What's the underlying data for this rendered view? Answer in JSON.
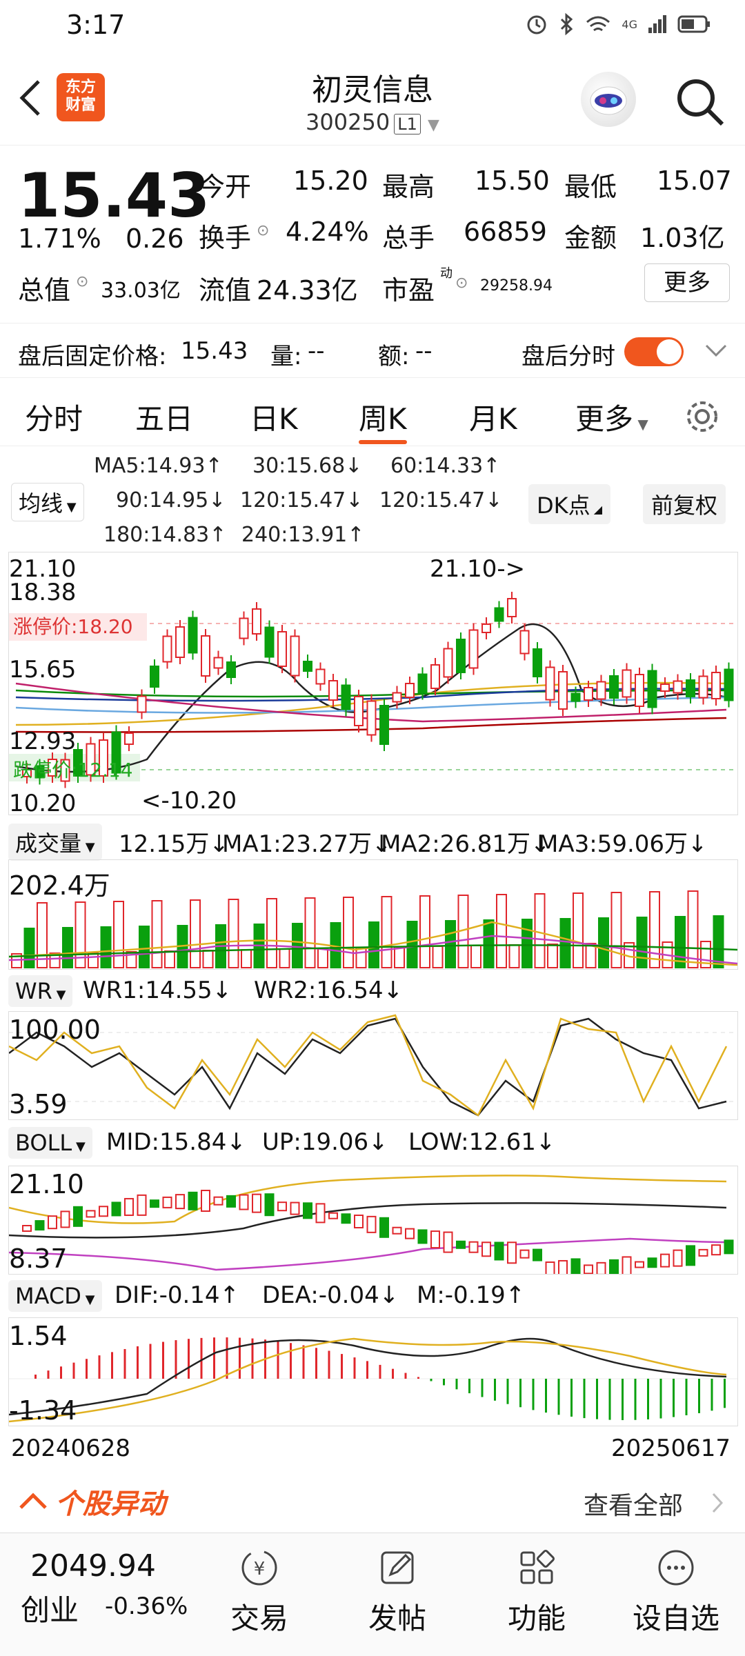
{
  "status_bar": {
    "time": "3:17",
    "signal": "4G"
  },
  "header": {
    "brand_logo_text": "东方\n财富",
    "title": "初灵信息",
    "code": "300250",
    "level": "L1"
  },
  "quote": {
    "price": "15.43",
    "change_pct": "1.71%",
    "change": "0.26",
    "open_label": "今开",
    "open": "15.20",
    "high_label": "最高",
    "high": "15.50",
    "low_label": "最低",
    "low": "15.07",
    "turnover_label": "换手",
    "turnover": "4.24%",
    "volume_label": "总手",
    "volume": "66859",
    "amount_label": "金额",
    "amount": "1.03亿",
    "mktcap_label": "总值",
    "mktcap": "33.03亿",
    "float_label": "流值",
    "float": "24.33亿",
    "pe_label": "市盈",
    "pe_sup": "动",
    "pe": "29258.94",
    "more": "更多"
  },
  "after_hours": {
    "fixed_price_label": "盘后固定价格:",
    "fixed_price": "15.43",
    "qty_label": "量:",
    "qty": "--",
    "amt_label": "额:",
    "amt": "--",
    "toggle_label": "盘后分时",
    "toggle_on": true
  },
  "tabs": [
    "分时",
    "五日",
    "日K",
    "周K",
    "月K",
    "更多"
  ],
  "active_tab": "周K",
  "ma_legend": {
    "selector": "均线",
    "items": [
      "MA5:14.93↑",
      "30:15.68↓",
      "60:14.33↑",
      "90:14.95↓",
      "120:15.47↓",
      "120:15.47↓",
      "180:14.83↑",
      "240:13.91↑"
    ],
    "dk": "DK点",
    "adjust": "前复权"
  },
  "kline": {
    "y_labels": [
      "21.10",
      "18.38",
      "15.65",
      "12.93",
      "10.20"
    ],
    "limit_up": "涨停价:18.20",
    "limit_down": "跌停价:12.14",
    "max_marker": "21.10->",
    "min_marker": "<-10.20"
  },
  "volume_panel": {
    "selector": "成交量",
    "legend": [
      "12.15万↓",
      "MA1:23.27万↓",
      "MA2:26.81万↓",
      "MA3:59.06万↓"
    ],
    "ymax": "202.4万"
  },
  "wr_panel": {
    "selector": "WR",
    "legend": [
      "WR1:14.55↓",
      "WR2:16.54↓"
    ],
    "y_labels": [
      "100.00",
      "3.59"
    ]
  },
  "boll_panel": {
    "selector": "BOLL",
    "legend": [
      "MID:15.84↓",
      "UP:19.06↓",
      "LOW:12.61↓"
    ],
    "y_labels": [
      "21.10",
      "8.37"
    ]
  },
  "macd_panel": {
    "selector": "MACD",
    "legend": [
      "DIF:-0.14↑",
      "DEA:-0.04↓",
      "M:-0.19↑"
    ],
    "y_labels": [
      "1.54",
      "-1.34"
    ]
  },
  "date_range": {
    "start": "20240628",
    "end": "20250617"
  },
  "movement": {
    "title": "个股异动",
    "view_all": "查看全部"
  },
  "bottom_nav": {
    "index_value": "2049.94",
    "index_name": "创业",
    "index_change": "-0.36%",
    "items": [
      "交易",
      "发帖",
      "功能",
      "设自选"
    ]
  },
  "colors": {
    "accent": "#f0561e",
    "up": "#e0262b",
    "down": "#0aa00e"
  }
}
